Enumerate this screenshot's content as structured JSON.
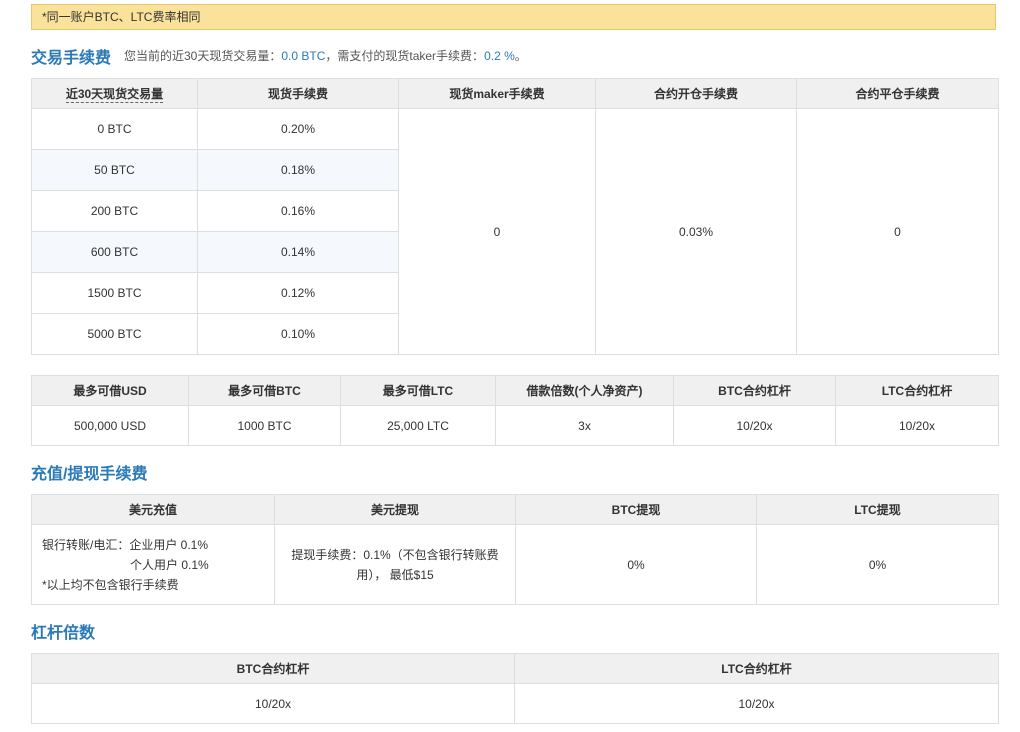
{
  "notice": "*同一账户BTC、LTC费率相同",
  "trading_fee": {
    "title": "交易手续费",
    "subtitle_prefix": "您当前的近30天现货交易量：",
    "volume": "0.0 BTC",
    "subtitle_mid": "，需支付的现货taker手续费：",
    "taker_fee": "0.2 %",
    "subtitle_suffix": "。",
    "headers": [
      "近30天现货交易量",
      "现货手续费",
      "现货maker手续费",
      "合约开仓手续费",
      "合约平仓手续费"
    ],
    "rows": [
      {
        "volume": "0 BTC",
        "fee": "0.20%"
      },
      {
        "volume": "50 BTC",
        "fee": "0.18%"
      },
      {
        "volume": "200 BTC",
        "fee": "0.16%"
      },
      {
        "volume": "600 BTC",
        "fee": "0.14%"
      },
      {
        "volume": "1500 BTC",
        "fee": "0.12%"
      },
      {
        "volume": "5000 BTC",
        "fee": "0.10%"
      }
    ],
    "maker_fee": "0",
    "open_fee": "0.03%",
    "close_fee": "0"
  },
  "borrow": {
    "headers": [
      "最多可借USD",
      "最多可借BTC",
      "最多可借LTC",
      "借款倍数(个人净资产)",
      "BTC合约杠杆",
      "LTC合约杠杆"
    ],
    "values": [
      "500,000 USD",
      "1000 BTC",
      "25,000 LTC",
      "3x",
      "10/20x",
      "10/20x"
    ]
  },
  "deposit": {
    "title": "充值/提现手续费",
    "headers": [
      "美元充值",
      "美元提现",
      "BTC提现",
      "LTC提现"
    ],
    "usd_deposit_line1": "银行转账/电汇：企业用户 0.1%",
    "usd_deposit_line2": "个人用户 0.1%",
    "usd_deposit_line3": "*以上均不包含银行手续费",
    "usd_withdraw_line1": "提现手续费：0.1%（不包含银行转账费",
    "usd_withdraw_line2": "用），  最低$15",
    "btc_withdraw": "0%",
    "ltc_withdraw": "0%"
  },
  "leverage": {
    "title": "杠杆倍数",
    "headers": [
      "BTC合约杠杆",
      "LTC合约杠杆"
    ],
    "values": [
      "10/20x",
      "10/20x"
    ]
  }
}
